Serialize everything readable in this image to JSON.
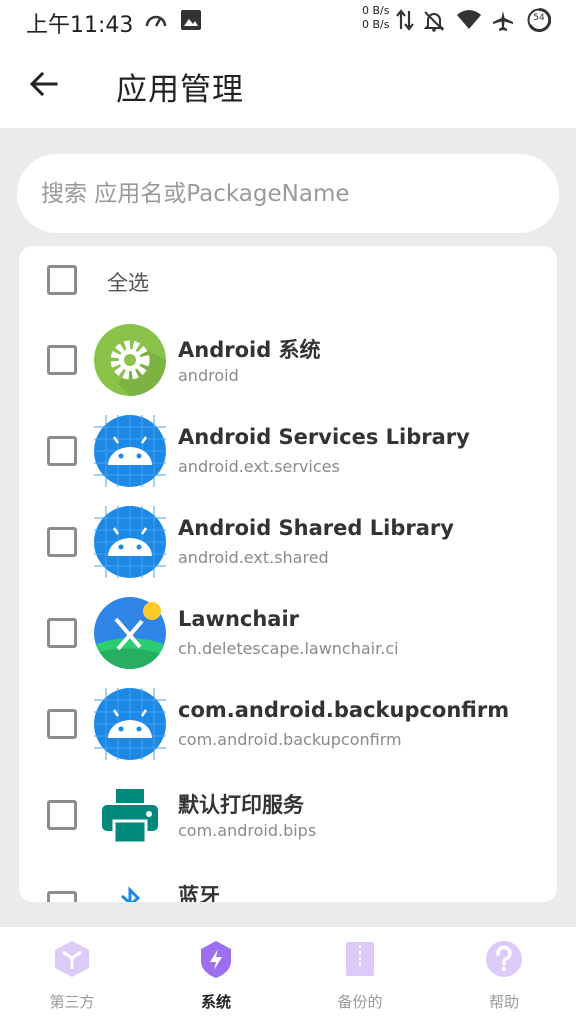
{
  "status_bar": {
    "time": "上午11:43",
    "net_up": "0 B/s",
    "net_down": "0 B/s",
    "battery": "54"
  },
  "app_bar": {
    "title": "应用管理",
    "back_icon": "arrow-left-icon"
  },
  "search": {
    "placeholder": "搜索 应用名或PackageName"
  },
  "list": {
    "select_all_label": "全选",
    "apps": [
      {
        "name": "Android 系统",
        "package": "android",
        "icon": "settings-gear-icon"
      },
      {
        "name": "Android Services Library",
        "package": "android.ext.services",
        "icon": "android-robot-icon"
      },
      {
        "name": "Android Shared Library",
        "package": "android.ext.shared",
        "icon": "android-robot-icon"
      },
      {
        "name": "Lawnchair",
        "package": "ch.deletescape.lawnchair.ci",
        "icon": "lawnchair-icon"
      },
      {
        "name": "com.android.backupconfirm",
        "package": "com.android.backupconfirm",
        "icon": "android-robot-icon"
      },
      {
        "name": "默认打印服务",
        "package": "com.android.bips",
        "icon": "printer-icon"
      },
      {
        "name": "蓝牙",
        "package": "",
        "icon": "bluetooth-icon"
      }
    ]
  },
  "bottom_nav": {
    "items": [
      {
        "label": "第三方",
        "icon": "third-party-cube-icon"
      },
      {
        "label": "系统",
        "icon": "system-bolt-shield-icon",
        "active": true
      },
      {
        "label": "备份的",
        "icon": "backup-archive-icon"
      },
      {
        "label": "帮助",
        "icon": "help-question-icon"
      }
    ]
  },
  "colors": {
    "accent_purple": "#9c6ff0",
    "accent_light_purple": "#dccbf9",
    "checkbox_border": "#8c8c8c",
    "background": "#ebebeb"
  }
}
